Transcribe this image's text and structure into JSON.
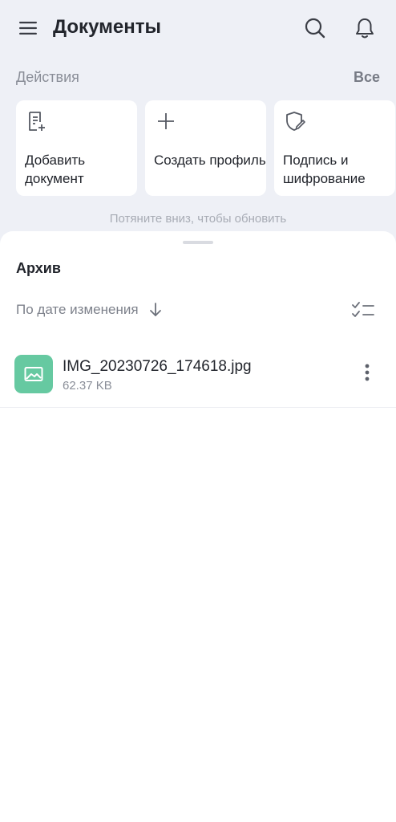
{
  "header": {
    "title": "Документы",
    "menu_icon": "hamburger-menu-icon",
    "search_icon": "search-icon",
    "notifications_icon": "bell-icon"
  },
  "actions": {
    "title": "Действия",
    "all_label": "Все",
    "items": [
      {
        "label": "Добавить документ",
        "icon": "add-document-icon"
      },
      {
        "label": "Создать профиль",
        "icon": "plus-icon"
      },
      {
        "label": "Подпись и шифрование",
        "icon": "shield-pen-icon"
      }
    ]
  },
  "pull_hint": "Потяните вниз, чтобы обновить",
  "archive": {
    "title": "Архив",
    "sort_label": "По дате изменения",
    "sort_icon": "arrow-down-icon",
    "select_icon": "checklist-icon",
    "files": [
      {
        "name": "IMG_20230726_174618.jpg",
        "size": "62.37 KB",
        "icon": "image-file-icon",
        "thumb_color": "#66c9a1"
      }
    ]
  },
  "colors": {
    "background": "#eef0f6",
    "surface": "#ffffff",
    "text_primary": "#22252c",
    "text_secondary": "#8a8e98"
  }
}
